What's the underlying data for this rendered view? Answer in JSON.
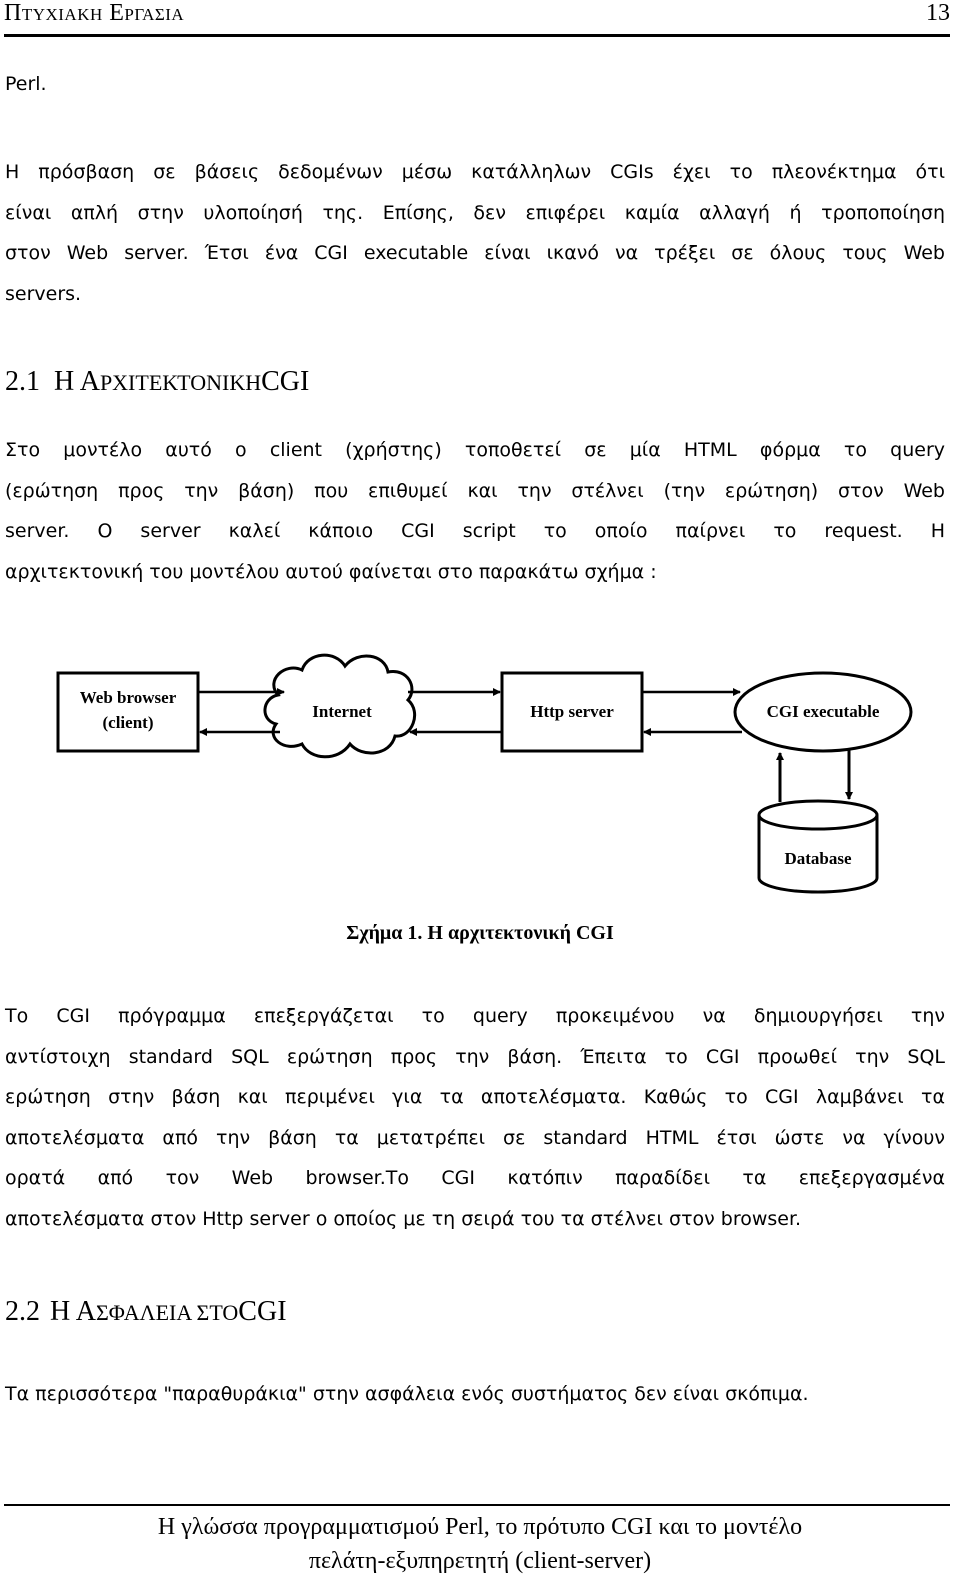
{
  "header": {
    "title": "Πτυχιακη Εργασια",
    "page_number": "13"
  },
  "intro": {
    "lines": [
      "Perl."
    ]
  },
  "paragraph1": {
    "lines": [
      "Η πρόσβαση σε βάσεις δεδομένων μέσω κατάλληλων CGIs έχει το πλεονέκτημα ότι",
      "είναι απλή στην υλοποίησή της. Επίσης, δεν επιφέρει καμία αλλαγή ή τροποποίηση",
      "στον Web server. Έτσι ένα CGI executable είναι ικανό να τρέξει σε όλους τους Web",
      "servers."
    ]
  },
  "section_2_1": {
    "number": "2.1",
    "title_first": "Η",
    "title_cap": "Α",
    "title_rest": "ΡΧΙΤΕΚΤΟΝΙΚΗ",
    "title_tail": "CGI"
  },
  "paragraph2": {
    "lines": [
      "Στο μοντέλο αυτό ο client (χρήστης) τοποθετεί σε μία HTML φόρμα το query",
      "(ερώτηση προς την βάση) που επιθυμεί και την στέλνει (την ερώτηση) στον Web",
      "server. Ο server καλεί κάποιο CGI script το οποίο παίρνει το request. Η",
      "αρχιτεκτονική του μοντέλου αυτού φαίνεται στο παρακάτω σχήμα :"
    ]
  },
  "figure": {
    "nodes": {
      "web_browser": [
        "Web browser",
        "(client)"
      ],
      "internet": "Internet",
      "http_server": "Http server",
      "cgi_executable": "CGI executable",
      "database": "Database"
    },
    "caption": "Σχήμα 1.  Η αρχιτεκτονική CGI"
  },
  "paragraph3": {
    "lines": [
      "Το CGI πρόγραμμα επεξεργάζεται το query προκειμένου να δημιουργήσει την",
      "αντίστοιχη standard SQL ερώτηση προς την βάση. Έπειτα το CGI προωθεί την SQL",
      "ερώτηση στην βάση και περιμένει για τα αποτελέσματα. Καθώς το CGI λαμβάνει τα",
      "αποτελέσματα από την βάση τα μετατρέπει σε standard HTML έτσι ώστε να γίνουν",
      "ορατά από τον Web browser.Το CGI κατόπιν παραδίδει τα επεξεργασμένα",
      "αποτελέσματα στον Http server ο οποίος με τη σειρά του τα στέλνει στον browser."
    ]
  },
  "section_2_2": {
    "number": "2.2",
    "title_first": "Η",
    "title_cap": "Α",
    "title_rest": "ΣΦΑΛΕΙΑ ΣΤΟ",
    "title_tail": "CGI"
  },
  "paragraph4": {
    "lines": [
      "Τα περισσότερα \"παραθυράκια\" στην ασφάλεια ενός συστήματος δεν είναι σκόπιμα."
    ]
  },
  "footer": {
    "line1": "Η γλώσσα προγραμματισμού Perl, το πρότυπο CGI και το μοντέλο",
    "line2": "πελάτη-εξυπηρετητή (client-server)"
  }
}
